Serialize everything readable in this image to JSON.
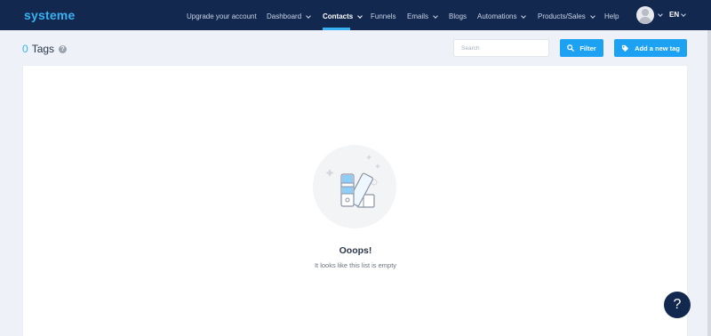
{
  "brand": {
    "logo_text": "systeme",
    "accent_color": "#38b1f3",
    "nav_bg": "#13284f"
  },
  "nav": {
    "items": [
      {
        "label": "Upgrade your account",
        "has_dropdown": false,
        "active": false
      },
      {
        "label": "Dashboard",
        "has_dropdown": true,
        "active": false
      },
      {
        "label": "Contacts",
        "has_dropdown": true,
        "active": true
      },
      {
        "label": "Funnels",
        "has_dropdown": false,
        "active": false
      },
      {
        "label": "Emails",
        "has_dropdown": true,
        "active": false
      },
      {
        "label": "Blogs",
        "has_dropdown": false,
        "active": false
      },
      {
        "label": "Automations",
        "has_dropdown": true,
        "active": false
      },
      {
        "label": "Products/Sales",
        "has_dropdown": true,
        "active": false
      },
      {
        "label": "Help",
        "has_dropdown": false,
        "active": false
      }
    ],
    "language": "EN",
    "avatar_icon": "user-avatar-icon"
  },
  "page": {
    "count": "0",
    "title": "Tags",
    "help_icon": "question-circle-icon",
    "search_placeholder": "Search",
    "filter_label": "Filter",
    "add_label": "Add a new tag"
  },
  "empty_state": {
    "title": "Ooops!",
    "subtitle": "It looks like this list is empty",
    "icon": "color-swatch-icon"
  },
  "help_bubble": {
    "label": "?"
  }
}
